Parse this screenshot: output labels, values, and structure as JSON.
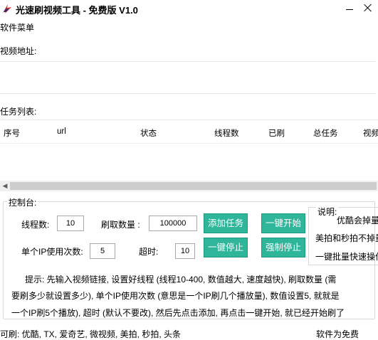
{
  "window": {
    "title": "光速刷视频工具 - 免费版 V1.0",
    "icon": "lightning-bolt-icon"
  },
  "menu": {
    "label": "软件菜单"
  },
  "url": {
    "label": "视频地址:",
    "value": ""
  },
  "tasks": {
    "label": "任务列表:",
    "columns": [
      "序号",
      "url",
      "状态",
      "线程数",
      "已刷",
      "总任务",
      "视频"
    ],
    "rows": []
  },
  "control": {
    "legend": "控制台:",
    "threads_label": "线程数:",
    "threads_value": "10",
    "count_label": "刷取数量 :",
    "count_value": "100000",
    "per_ip_label": "单个IP使用次数:",
    "per_ip_value": "5",
    "timeout_label": "超时:",
    "timeout_value": "10",
    "btn_add": "添加任务",
    "btn_start": "一键开始",
    "btn_stop": "一键停止",
    "btn_force_stop": "强制停止"
  },
  "notes": {
    "legend": "说明:",
    "lines": [
      "优酷会掉量",
      "美拍和秒拍不掉量",
      "一键批量快速操作"
    ]
  },
  "tips": {
    "line1": "提示: 先输入视频链接, 设置好线程 (线程10-400, 数值越大, 速度越快), 刷取数量 (需",
    "line2": "要刷多少就设置多少), 单个IP使用次数 (意思是一个IP刷几个播放量), 数值设置5, 就就是",
    "line3": "一个IP刷5个播放), 超时 (默认不要改), 然后先点击添加, 再点击一键开始, 就已经开始刷了"
  },
  "status": {
    "left": "可刷: 优酷, TX, 爱奇艺, 微视频, 美拍, 秒拍, 头条",
    "right": "软件为免费"
  },
  "colors": {
    "button_green": "#2fb59a",
    "window_bg": "#ffffff"
  }
}
